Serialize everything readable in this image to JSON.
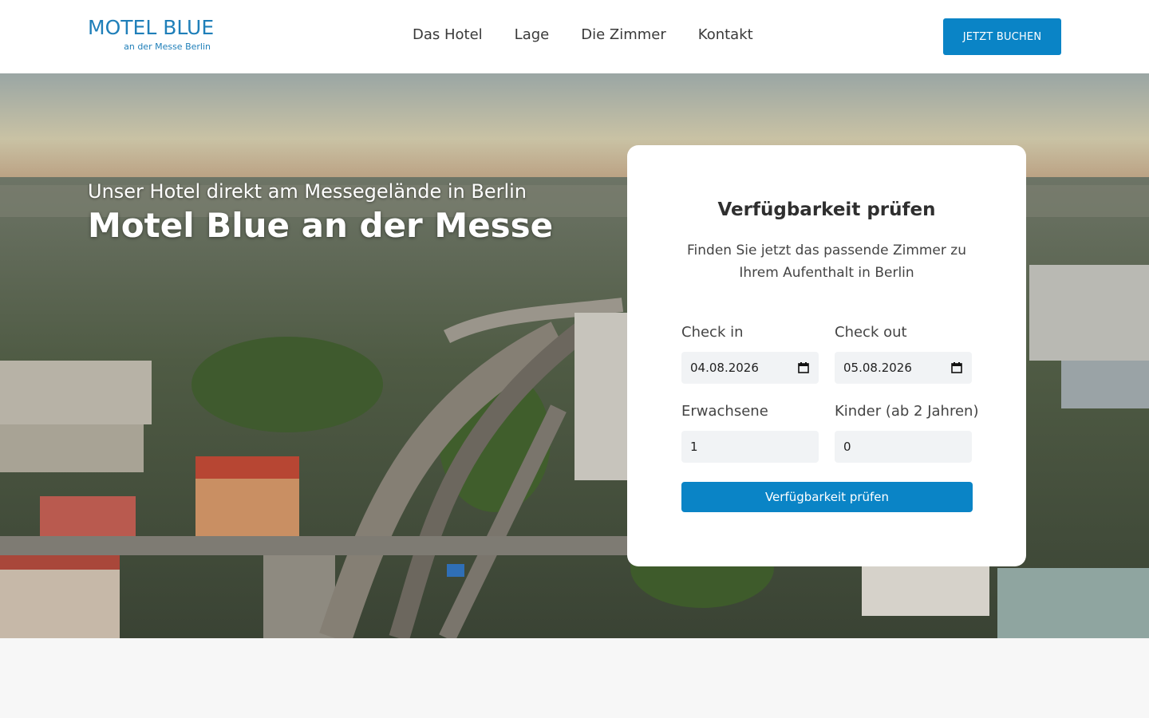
{
  "header": {
    "logo_main": "MOTEL BLUE",
    "logo_sub": "an der Messe Berlin",
    "nav": [
      {
        "label": "Das Hotel"
      },
      {
        "label": "Lage"
      },
      {
        "label": "Die Zimmer"
      },
      {
        "label": "Kontakt"
      }
    ],
    "book_button": "JETZT BUCHEN"
  },
  "hero": {
    "subtitle": "Unser Hotel direkt am Messegelände in Berlin",
    "title": "Motel Blue an der Messe"
  },
  "booking": {
    "title": "Verfügbarkeit prüfen",
    "text": "Finden Sie jetzt das passende Zimmer zu Ihrem Aufenthalt in Berlin",
    "checkin_label": "Check in",
    "checkin_value": "04.08.2026",
    "checkout_label": "Check out",
    "checkout_value": "05.08.2026",
    "adults_label": "Erwachsene",
    "adults_value": "1",
    "children_label": "Kinder (ab 2 Jahren)",
    "children_value": "0",
    "submit": "Verfügbarkeit prüfen"
  },
  "colors": {
    "brand": "#1f7fb9",
    "button": "#0a84c6"
  }
}
